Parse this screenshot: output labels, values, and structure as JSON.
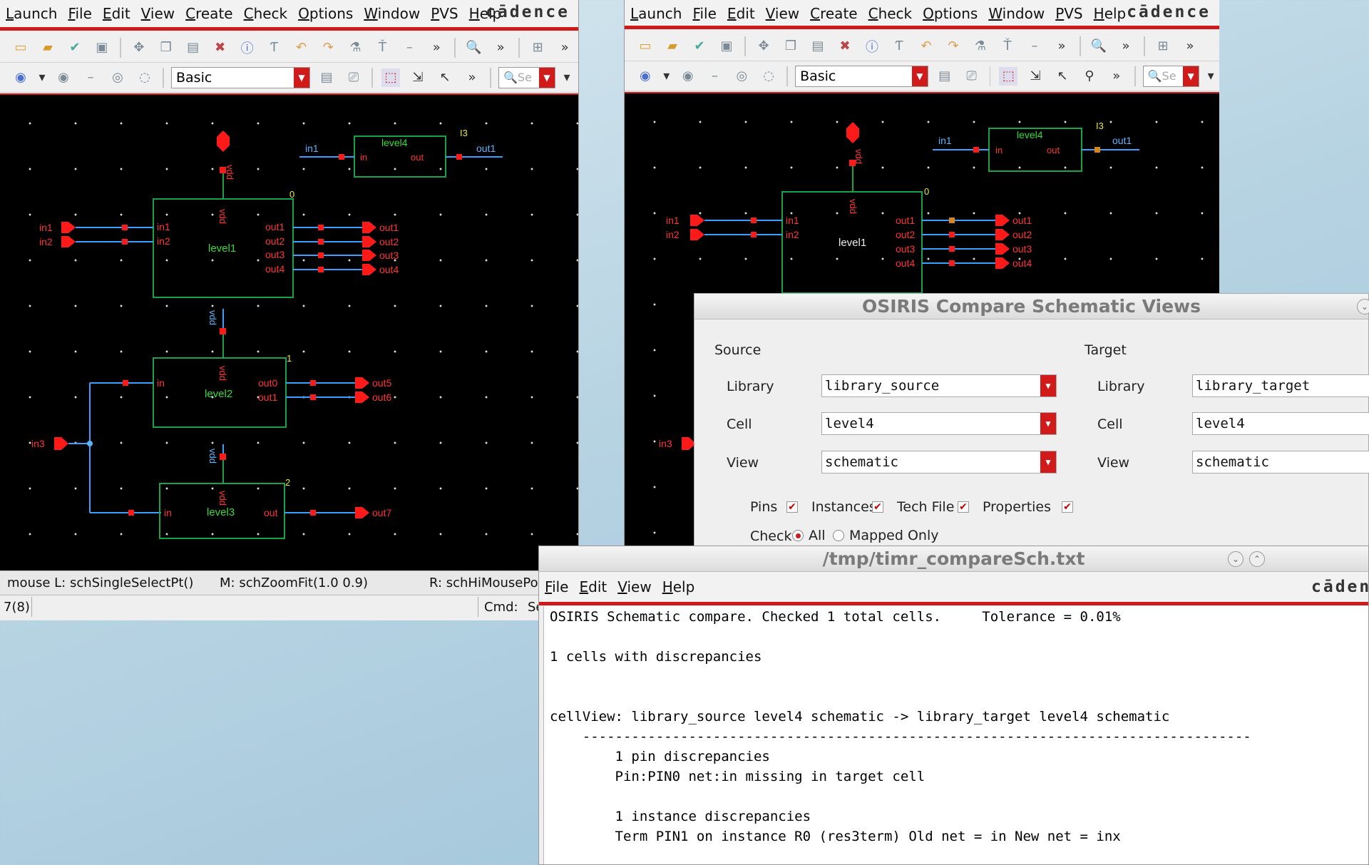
{
  "menu_items": [
    "Launch",
    "File",
    "Edit",
    "View",
    "Create",
    "Check",
    "Options",
    "Window",
    "PVS",
    "Help"
  ],
  "brand": "cādence",
  "toolbar": {
    "mode_combo": "Basic",
    "search_placeholder": "Se"
  },
  "left_window": {
    "status": {
      "mouse_left": "mouse L: schSingleSelectPt()",
      "mouse_middle": "M: schZoomFit(1.0 0.9)",
      "mouse_right": "R: schHiMousePo",
      "count": "7(8)",
      "cmd_label": "Cmd:",
      "cmd_value": "Se"
    },
    "schematic": {
      "top_pin": "vdd",
      "level1": {
        "name": "level1",
        "index": "0",
        "vdd": "vdd",
        "inputs": [
          "in1",
          "in2"
        ],
        "outputs": [
          "out1",
          "out2",
          "out3",
          "out4"
        ]
      },
      "level2": {
        "name": "level2",
        "index": "1",
        "vdd": "vdd",
        "input": "in",
        "outputs": [
          "out0",
          "out1"
        ],
        "ext_outputs": [
          "out5",
          "out6"
        ]
      },
      "level3": {
        "name": "level3",
        "index": "2",
        "vdd": "vdd",
        "input": "in",
        "output": "out",
        "ext_output": "out7"
      },
      "level4": {
        "name": "level4",
        "instance": "I3",
        "input": "in",
        "output": "out",
        "in_net": "in1",
        "out_net": "out1"
      },
      "ext_inputs": [
        "in1",
        "in2",
        "in3"
      ],
      "ext_outputs": [
        "out1",
        "out2",
        "out3",
        "out4"
      ],
      "vdd_wire": "vdd"
    }
  },
  "right_window": {
    "schematic": {
      "level1_name": "level1",
      "level1_index": "0",
      "level4_name": "level4",
      "level4_instance": "I3",
      "pins_in": [
        "in1",
        "in2"
      ],
      "pins_in3": "in3",
      "level1_inputs": [
        "in1",
        "in2"
      ],
      "level1_outputs": [
        "out1",
        "out2",
        "out3",
        "out4"
      ],
      "ext_outputs": [
        "out1",
        "out2",
        "out3",
        "out4"
      ],
      "level4_in_net": "in1",
      "level4_out_net": "out1",
      "level4_in": "in",
      "level4_out": "out",
      "vdd": "vdd"
    }
  },
  "compare_dialog": {
    "title": "OSIRIS Compare Schematic Views",
    "source_label": "Source",
    "target_label": "Target",
    "library_label": "Library",
    "cell_label": "Cell",
    "view_label": "View",
    "source_library": "library_source",
    "source_cell": "level4",
    "source_view": "schematic",
    "target_library": "library_target",
    "target_cell": "level4",
    "target_view": "schematic",
    "checks": {
      "pins": "Pins",
      "instances": "Instances",
      "techfile": "Tech File",
      "properties": "Properties"
    },
    "check_label": "Check",
    "radio_all": "All",
    "radio_mapped": "Mapped Only"
  },
  "report_window": {
    "title": "/tmp/timr_compareSch.txt",
    "menu": [
      "File",
      "Edit",
      "View",
      "Help"
    ],
    "brand": "cāden",
    "lines": [
      "OSIRIS Schematic compare. Checked 1 total cells.     Tolerance = 0.01%",
      "",
      "1 cells with discrepancies",
      "",
      "",
      "cellView: library_source level4 schematic -> library_target level4 schematic",
      "    ----------------------------------------------------------------------------------",
      "        1 pin discrepancies",
      "        Pin:PIN0 net:in missing in target cell",
      "",
      "        1 instance discrepancies",
      "        Term PIN1 on instance R0 (res3term) Old net = in New net = inx"
    ]
  },
  "colors": {
    "accent_red": "#d01a1a",
    "wire": "#3aa0ff",
    "box": "#16a34a",
    "pin": "#ff1a1a",
    "label_green": "#33dd33",
    "label_blue": "#5ab4ff"
  }
}
